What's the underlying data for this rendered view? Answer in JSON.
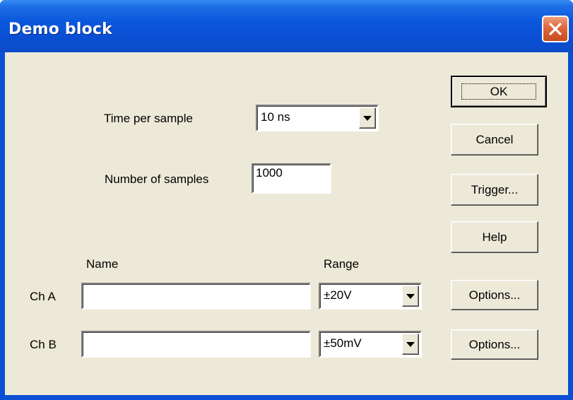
{
  "window": {
    "title": "Demo block",
    "close_icon": "close-icon"
  },
  "settings": {
    "time_per_sample_label": "Time per sample",
    "time_per_sample_value": "10 ns",
    "number_of_samples_label": "Number of samples",
    "number_of_samples_value": "1000"
  },
  "channels": {
    "name_header": "Name",
    "range_header": "Range",
    "rows": [
      {
        "label": "Ch A",
        "name": "",
        "range": "±20V",
        "options": "Options..."
      },
      {
        "label": "Ch B",
        "name": "",
        "range": "±50mV",
        "options": "Options..."
      }
    ]
  },
  "buttons": {
    "ok": "OK",
    "cancel": "Cancel",
    "trigger": "Trigger...",
    "help": "Help"
  },
  "colors": {
    "titlebar": "#0a4fd4",
    "client": "#ece9d8",
    "close": "#e06a40"
  }
}
